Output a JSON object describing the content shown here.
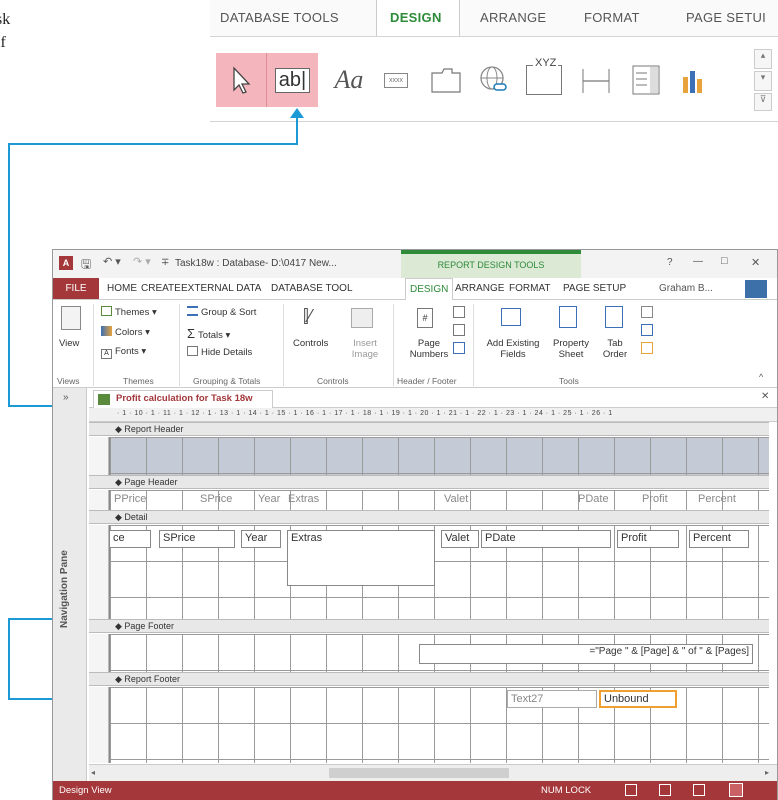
{
  "top_crop": {
    "tabs": [
      "DATABASE TOOLS",
      "DESIGN",
      "ARRANGE",
      "FORMAT",
      "PAGE SETUI"
    ],
    "controls": [
      "select-arrow",
      "textbox",
      "label",
      "button",
      "tab-control",
      "hyperlink",
      "web-browser",
      "navigation",
      "option-group",
      "page-break",
      "combo-box",
      "chart"
    ],
    "textbox_glyph": "ab|",
    "label_glyph": "Aa",
    "button_glyph": "xxxx",
    "xyz_glyph": "XYZ"
  },
  "window": {
    "title": "Task18w : Database- D:\\0417 New...",
    "context_tab": "REPORT DESIGN TOOLS",
    "help": "?",
    "min": "—",
    "max": "□",
    "close": "✕",
    "user": "Graham B...",
    "ribbon_tabs": [
      "FILE",
      "HOME",
      "CREATE",
      "EXTERNAL DATA",
      "DATABASE TOOL",
      "DESIGN",
      "ARRANGE",
      "FORMAT",
      "PAGE SETUP"
    ],
    "ribbon": {
      "view": "View",
      "themes": "Themes",
      "colors": "Colors",
      "fonts": "Fonts",
      "group_sort": "Group & Sort",
      "totals": "Totals",
      "hide_details": "Hide Details",
      "controls": "Controls",
      "insert_image": "Insert Image",
      "page_numbers": "Page Numbers",
      "add_existing": "Add Existing Fields",
      "property_sheet": "Property Sheet",
      "tab_order": "Tab Order",
      "groups": [
        "Views",
        "Themes",
        "Grouping & Totals",
        "Controls",
        "Header / Footer",
        "Tools"
      ]
    },
    "nav_pane": "Navigation Pane",
    "doc_tab": "Profit calculation for Task 18w",
    "ruler": "· 1 · 10 · 1 · 11 · 1 · 12 · 1 · 13 · 1 · 14 · 1 · 15 · 1 · 16 · 1 · 17 · 1 · 18 · 1 · 19 · 1 · 20 · 1 · 21 · 1 · 22 · 1 · 23 · 1 · 24 · 1 · 25 · 1 · 26 · 1",
    "sections": [
      "Report Header",
      "Page Header",
      "Detail",
      "Page Footer",
      "Report Footer"
    ],
    "page_header_labels": [
      "PPrice",
      "SPrice",
      "Year",
      "Extras",
      "Valet",
      "PDate",
      "Profit",
      "Percent"
    ],
    "detail_fields": [
      "ce",
      "SPrice",
      "Year",
      "Extras",
      "Valet",
      "PDate",
      "Profit",
      "Percent"
    ],
    "page_footer_expr": "=\"Page \" & [Page] & \" of \" & [Pages]",
    "footer_label": "Text27",
    "footer_field": "Unbound",
    "status_left": "Design View",
    "status_numlock": "NUM LOCK"
  },
  "colors": {
    "accent": "#a4373a",
    "connector": "#1b9ad6",
    "highlight_pink": "#f4b6bc",
    "selected_orange": "#f0a030",
    "design_green": "#2e8b3a"
  }
}
